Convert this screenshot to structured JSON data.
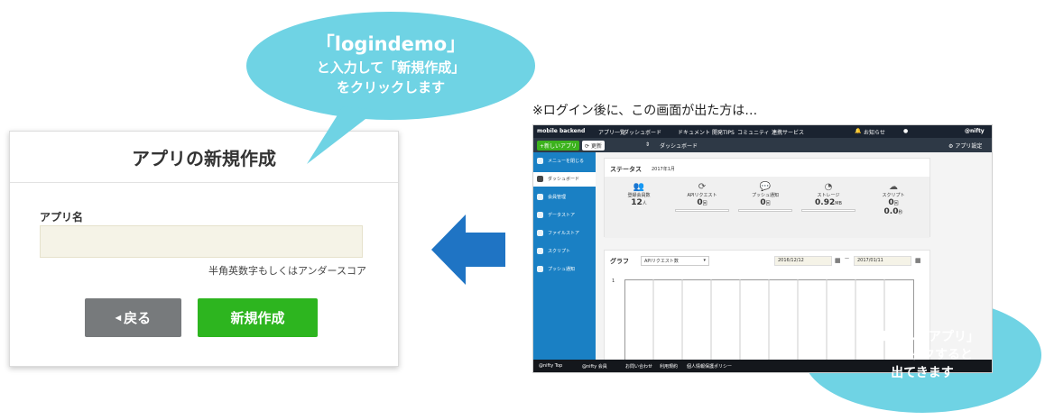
{
  "dialog": {
    "title": "アプリの新規作成",
    "app_name_label": "アプリ名",
    "app_name_value": "",
    "hint": "半角英数字もしくはアンダースコア",
    "back_label": "戻る",
    "create_label": "新規作成"
  },
  "bubble_top": {
    "line1": "「logindemo」",
    "line2": "と入力して「新規作成」",
    "line3": "をクリックします"
  },
  "note": "※ログイン後に、この画面が出た方は…",
  "bubble_bottom": {
    "line1": "「＋新しいアプリ」",
    "line2": "をクリックすると",
    "line3": "出てきます"
  },
  "colors": {
    "bubble": "#6fd3e4",
    "arrow": "#1f74c4",
    "create_button": "#2db51f",
    "back_button": "#777a7c",
    "sidebar": "#1a80c4"
  },
  "screenshot": {
    "logo": "mobile backend",
    "nav": [
      "アプリ一覧",
      "ダッシュボード",
      "ドキュメント",
      "開発TIPS",
      "コミュニティ",
      "連携サービス"
    ],
    "notice": "お知らせ",
    "brand": "@nifty",
    "new_app_button": "+新しいアプリ",
    "refresh_button": "更新",
    "breadcrumb": "ダッシュボード",
    "app_settings": "アプリ設定",
    "sidebar": [
      "メニューを閉じる",
      "ダッシュボード",
      "会員管理",
      "データストア",
      "ファイルストア",
      "スクリプト",
      "プッシュ通知"
    ],
    "status_title": "ステータス",
    "status_month": "2017年1月",
    "stats": [
      {
        "label": "登録会員数",
        "value": "12",
        "unit": "人"
      },
      {
        "label": "APIリクエスト",
        "value": "0",
        "unit": "回"
      },
      {
        "label": "プッシュ通知",
        "value": "0",
        "unit": "回"
      },
      {
        "label": "ストレージ",
        "value": "0.92",
        "unit": "MB"
      },
      {
        "label": "スクリプト",
        "value": "0",
        "unit": "回",
        "value2": "0.0",
        "unit2": "秒"
      }
    ],
    "graph_title": "グラフ",
    "graph_select": "APIリクエスト数",
    "date_from": "2016/12/12",
    "date_sep": "—",
    "date_to": "2017/01/11",
    "graph_axis_max": "1",
    "footer": [
      "@nifty Top",
      "@nifty 会員",
      "お問い合わせ",
      "利用規約",
      "個人情報保護ポリシー"
    ]
  }
}
